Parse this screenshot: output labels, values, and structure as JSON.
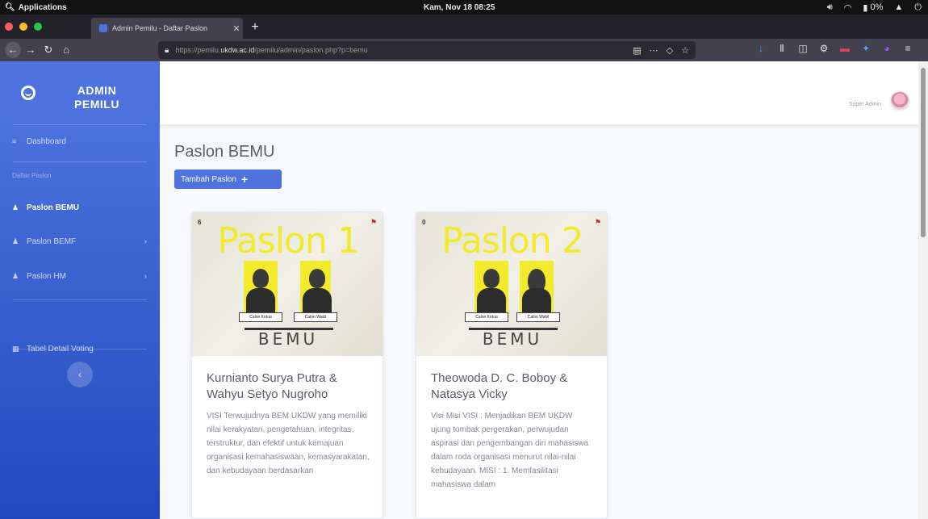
{
  "os": {
    "apps_label": "Applications",
    "clock": "Kam, Nov 18   08:25",
    "battery": "0%"
  },
  "browser": {
    "tab_title": "Admin Pemilu - Daftar Paslon",
    "url_prefix": "https://pemilu.",
    "url_host": "ukdw.ac.id",
    "url_path": "/pemilu/admin/paslon.php?p=bemu"
  },
  "sidebar": {
    "brand_line1": "ADMIN",
    "brand_line2": "PEMILU",
    "dashboard_label": "Dashboard",
    "heading": "Daftar Paslon",
    "items": [
      {
        "label": "Paslon BEMU"
      },
      {
        "label": "Paslon BEMF"
      },
      {
        "label": "Paslon HM"
      },
      {
        "label": "Tabel Detail Voting"
      }
    ],
    "toggle_icon": "chevron-left-icon"
  },
  "topbar": {
    "user_name": "Super Admin"
  },
  "main": {
    "title": "Paslon BEMU",
    "add_button": "Tambah Paslon",
    "add_icon": "+"
  },
  "cards": [
    {
      "poster_title": "Paslon 1",
      "poster_brand": "BEMU",
      "poster_corner": "6",
      "candidate_a": "Calon Ketua",
      "candidate_b": "Calon Wakil",
      "title": "Kurnianto Surya Putra & Wahyu Setyo Nugroho",
      "text": "VISI Terwujudnya BEM UKDW yang memiliki nilai kerakyatan, pengetahuan, integritas, terstruktur, dan efektif untuk kemajuan organisasi kemahasiswaan, kemasyarakatan, dan kebudayaan berdasarkan"
    },
    {
      "poster_title": "Paslon 2",
      "poster_brand": "BEMU",
      "poster_corner": "0",
      "candidate_a": "Calon Ketua",
      "candidate_b": "Calon Wakil",
      "title": "Theowoda D. C. Boboy & Natasya Vicky",
      "text": "Visi Misi VISI : Menjadikan BEM UKDW ujung tombak pergerakan, perwujudan aspirasi dan pengembangan diri mahasiswa dalam roda organisasi menurut nilai-nilai kebudayaan. MISI : 1. Memfasilitasi mahasiswa dalam"
    }
  ],
  "colors": {
    "sidebar_top": "#4e73df",
    "sidebar_bottom": "#224abe",
    "poster_yellow": "#f2ea2b"
  }
}
